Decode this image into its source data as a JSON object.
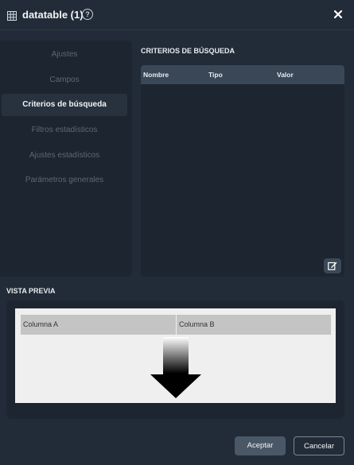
{
  "window": {
    "title": "datatable (1)",
    "help_symbol": "?",
    "icon": "grid-icon",
    "close_icon": "close-icon"
  },
  "sidebar": {
    "items": [
      {
        "label": "Ajustes",
        "active": false
      },
      {
        "label": "Campos",
        "active": false
      },
      {
        "label": "Criterios de búsqueda",
        "active": true
      },
      {
        "label": "Filtros estadísticos",
        "active": false
      },
      {
        "label": "Ajustes estadísticos",
        "active": false
      },
      {
        "label": "Parámetros generales",
        "active": false
      }
    ]
  },
  "criteria": {
    "title": "CRITERIOS DE BÚSQUEDA",
    "columns": [
      "Nombre",
      "Tipo",
      "Valor"
    ],
    "rows": [],
    "edit_icon": "edit-icon"
  },
  "preview": {
    "title": "VISTA PREVIA",
    "columns": [
      "Columna A",
      "Columna B"
    ]
  },
  "buttons": {
    "accept": "Aceptar",
    "cancel": "Cancelar"
  },
  "colors": {
    "background": "#222c38",
    "panel": "#1c2530",
    "table_header": "#3a4757",
    "active_item": "#28323f",
    "preview_canvas": "#efefef",
    "preview_column": "#c4c4c4"
  }
}
